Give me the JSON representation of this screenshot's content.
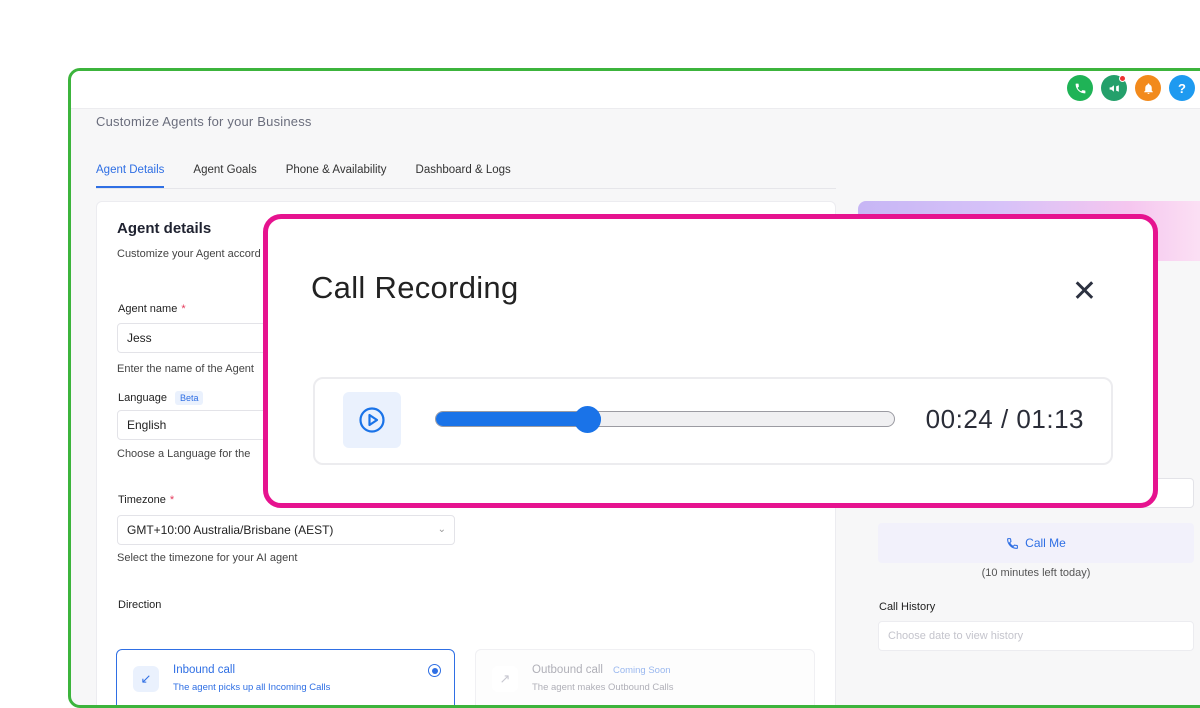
{
  "header": {
    "subtitle": "Customize Agents for your Business",
    "icons": [
      "phone-icon",
      "megaphone-icon",
      "bell-icon",
      "help-icon"
    ],
    "icon_colors": [
      "#1fb356",
      "#24a06b",
      "#f28a1c",
      "#1e9af0"
    ],
    "help_glyph": "?"
  },
  "tabs": [
    {
      "label": "Agent Details",
      "active": true
    },
    {
      "label": "Agent Goals",
      "active": false
    },
    {
      "label": "Phone & Availability",
      "active": false
    },
    {
      "label": "Dashboard & Logs",
      "active": false
    }
  ],
  "agent_details": {
    "title": "Agent details",
    "description": "Customize your Agent accord",
    "name_label": "Agent name",
    "required_mark": "*",
    "name_value": "Jess",
    "name_hint": "Enter the name of the Agent",
    "language_label": "Language",
    "language_badge": "Beta",
    "language_value": "English",
    "language_hint": "Choose a Language for the",
    "timezone_label": "Timezone",
    "timezone_value": "GMT+10:00 Australia/Brisbane (AEST)",
    "timezone_hint": "Select the timezone for your AI agent",
    "direction_label": "Direction",
    "inbound_title": "Inbound call",
    "inbound_sub": "The agent picks up all Incoming Calls",
    "outbound_title": "Outbound call",
    "outbound_badge": "Coming Soon",
    "outbound_sub": "The agent makes Outbound Calls"
  },
  "side_panel": {
    "call_me_label": "Call Me",
    "minutes_left": "(10 minutes left today)",
    "history_label": "Call History",
    "history_placeholder": "Choose date to view history"
  },
  "modal": {
    "title": "Call Recording",
    "close_glyph": "✕",
    "elapsed_time": "00:24",
    "time_separator": " / ",
    "total_time": "01:13",
    "progress_fraction": 0.329,
    "accent_color": "#1a73e8",
    "border_color": "#e6138f"
  },
  "accent_color": "#2f6fe4"
}
